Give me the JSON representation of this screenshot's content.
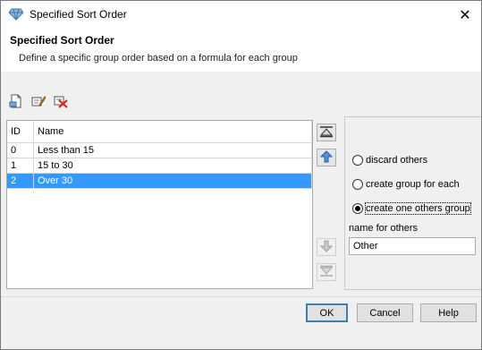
{
  "window": {
    "title": "Specified Sort Order",
    "close_glyph": "✕"
  },
  "header": {
    "title": "Specified Sort Order",
    "description": "Define a specific group order based on a formula for each group"
  },
  "toolbar": {
    "buttons": [
      {
        "icon": "new-document-icon"
      },
      {
        "icon": "edit-icon"
      },
      {
        "icon": "delete-icon"
      }
    ]
  },
  "table": {
    "columns": [
      "ID",
      "Name"
    ],
    "rows": [
      {
        "id": "0",
        "name": "Less than 15"
      },
      {
        "id": "1",
        "name": "15 to 30"
      },
      {
        "id": "2",
        "name": "Over 30",
        "selected": true
      }
    ]
  },
  "side_buttons": [
    {
      "icon": "move-to-top-icon",
      "enabled": true
    },
    {
      "icon": "move-up-icon",
      "enabled": true
    },
    {
      "icon": "move-down-icon",
      "enabled": false
    },
    {
      "icon": "move-to-bottom-icon",
      "enabled": false
    }
  ],
  "options": {
    "radios": [
      {
        "label": "discard others",
        "checked": false
      },
      {
        "label": "create group for each",
        "checked": false
      },
      {
        "label": "create one others group",
        "checked": true
      }
    ],
    "others_label": "name for others",
    "others_value": "Other"
  },
  "buttons": {
    "ok": "OK",
    "cancel": "Cancel",
    "help": "Help"
  },
  "colors": {
    "selection": "#3399ff",
    "default_button_border": "#3c7fb1"
  }
}
